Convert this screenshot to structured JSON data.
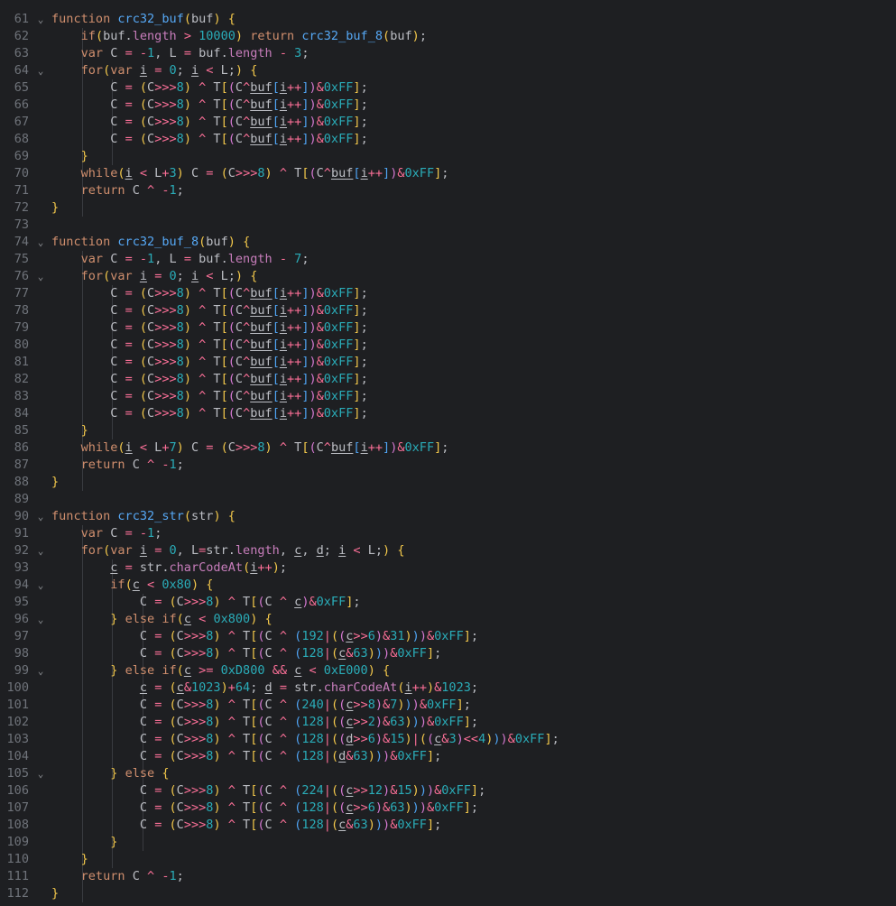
{
  "editor": {
    "lines": [
      {
        "n": "61",
        "fold": "⌄",
        "code": "function crc32_buf(buf) {"
      },
      {
        "n": "62",
        "fold": "",
        "code": "    if(buf.length > 10000) return crc32_buf_8(buf);"
      },
      {
        "n": "63",
        "fold": "",
        "code": "    var C = -1, L = buf.length - 3;"
      },
      {
        "n": "64",
        "fold": "⌄",
        "code": "    for(var i = 0; i < L;) {"
      },
      {
        "n": "65",
        "fold": "",
        "code": "        C = (C>>>8) ^ T[(C^buf[i++])&0xFF];"
      },
      {
        "n": "66",
        "fold": "",
        "code": "        C = (C>>>8) ^ T[(C^buf[i++])&0xFF];"
      },
      {
        "n": "67",
        "fold": "",
        "code": "        C = (C>>>8) ^ T[(C^buf[i++])&0xFF];"
      },
      {
        "n": "68",
        "fold": "",
        "code": "        C = (C>>>8) ^ T[(C^buf[i++])&0xFF];"
      },
      {
        "n": "69",
        "fold": "",
        "code": "    }"
      },
      {
        "n": "70",
        "fold": "",
        "code": "    while(i < L+3) C = (C>>>8) ^ T[(C^buf[i++])&0xFF];"
      },
      {
        "n": "71",
        "fold": "",
        "code": "    return C ^ -1;"
      },
      {
        "n": "72",
        "fold": "",
        "code": "}"
      },
      {
        "n": "73",
        "fold": "",
        "code": ""
      },
      {
        "n": "74",
        "fold": "⌄",
        "code": "function crc32_buf_8(buf) {"
      },
      {
        "n": "75",
        "fold": "",
        "code": "    var C = -1, L = buf.length - 7;"
      },
      {
        "n": "76",
        "fold": "⌄",
        "code": "    for(var i = 0; i < L;) {"
      },
      {
        "n": "77",
        "fold": "",
        "code": "        C = (C>>>8) ^ T[(C^buf[i++])&0xFF];"
      },
      {
        "n": "78",
        "fold": "",
        "code": "        C = (C>>>8) ^ T[(C^buf[i++])&0xFF];"
      },
      {
        "n": "79",
        "fold": "",
        "code": "        C = (C>>>8) ^ T[(C^buf[i++])&0xFF];"
      },
      {
        "n": "80",
        "fold": "",
        "code": "        C = (C>>>8) ^ T[(C^buf[i++])&0xFF];"
      },
      {
        "n": "81",
        "fold": "",
        "code": "        C = (C>>>8) ^ T[(C^buf[i++])&0xFF];"
      },
      {
        "n": "82",
        "fold": "",
        "code": "        C = (C>>>8) ^ T[(C^buf[i++])&0xFF];"
      },
      {
        "n": "83",
        "fold": "",
        "code": "        C = (C>>>8) ^ T[(C^buf[i++])&0xFF];"
      },
      {
        "n": "84",
        "fold": "",
        "code": "        C = (C>>>8) ^ T[(C^buf[i++])&0xFF];"
      },
      {
        "n": "85",
        "fold": "",
        "code": "    }"
      },
      {
        "n": "86",
        "fold": "",
        "code": "    while(i < L+7) C = (C>>>8) ^ T[(C^buf[i++])&0xFF];"
      },
      {
        "n": "87",
        "fold": "",
        "code": "    return C ^ -1;"
      },
      {
        "n": "88",
        "fold": "",
        "code": "}"
      },
      {
        "n": "89",
        "fold": "",
        "code": ""
      },
      {
        "n": "90",
        "fold": "⌄",
        "code": "function crc32_str(str) {"
      },
      {
        "n": "91",
        "fold": "",
        "code": "    var C = -1;"
      },
      {
        "n": "92",
        "fold": "⌄",
        "code": "    for(var i = 0, L=str.length, c, d; i < L;) {"
      },
      {
        "n": "93",
        "fold": "",
        "code": "        c = str.charCodeAt(i++);"
      },
      {
        "n": "94",
        "fold": "⌄",
        "code": "        if(c < 0x80) {"
      },
      {
        "n": "95",
        "fold": "",
        "code": "            C = (C>>>8) ^ T[(C ^ c)&0xFF];"
      },
      {
        "n": "96",
        "fold": "⌄",
        "code": "        } else if(c < 0x800) {"
      },
      {
        "n": "97",
        "fold": "",
        "code": "            C = (C>>>8) ^ T[(C ^ (192|((c>>6)&31)))&0xFF];"
      },
      {
        "n": "98",
        "fold": "",
        "code": "            C = (C>>>8) ^ T[(C ^ (128|(c&63)))&0xFF];"
      },
      {
        "n": "99",
        "fold": "⌄",
        "code": "        } else if(c >= 0xD800 && c < 0xE000) {"
      },
      {
        "n": "100",
        "fold": "",
        "code": "            c = (c&1023)+64; d = str.charCodeAt(i++)&1023;"
      },
      {
        "n": "101",
        "fold": "",
        "code": "            C = (C>>>8) ^ T[(C ^ (240|((c>>8)&7)))&0xFF];"
      },
      {
        "n": "102",
        "fold": "",
        "code": "            C = (C>>>8) ^ T[(C ^ (128|((c>>2)&63)))&0xFF];"
      },
      {
        "n": "103",
        "fold": "",
        "code": "            C = (C>>>8) ^ T[(C ^ (128|((d>>6)&15)|((c&3)<<4)))&0xFF];"
      },
      {
        "n": "104",
        "fold": "",
        "code": "            C = (C>>>8) ^ T[(C ^ (128|(d&63)))&0xFF];"
      },
      {
        "n": "105",
        "fold": "⌄",
        "code": "        } else {"
      },
      {
        "n": "106",
        "fold": "",
        "code": "            C = (C>>>8) ^ T[(C ^ (224|((c>>12)&15)))&0xFF];"
      },
      {
        "n": "107",
        "fold": "",
        "code": "            C = (C>>>8) ^ T[(C ^ (128|((c>>6)&63)))&0xFF];"
      },
      {
        "n": "108",
        "fold": "",
        "code": "            C = (C>>>8) ^ T[(C ^ (128|(c&63)))&0xFF];"
      },
      {
        "n": "109",
        "fold": "",
        "code": "        }"
      },
      {
        "n": "110",
        "fold": "",
        "code": "    }"
      },
      {
        "n": "111",
        "fold": "",
        "code": "    return C ^ -1;"
      },
      {
        "n": "112",
        "fold": "",
        "code": "}"
      }
    ]
  },
  "theme": {
    "background": "#1e1f22",
    "line_number": "#6f737a",
    "keyword": "#cf8e6d",
    "function_name": "#56a8f5",
    "number": "#2aacb8",
    "operator": "#fa6f97",
    "bracket_1": "#f3c84b",
    "bracket_2": "#d479d1",
    "bracket_3": "#4fa3f2"
  }
}
